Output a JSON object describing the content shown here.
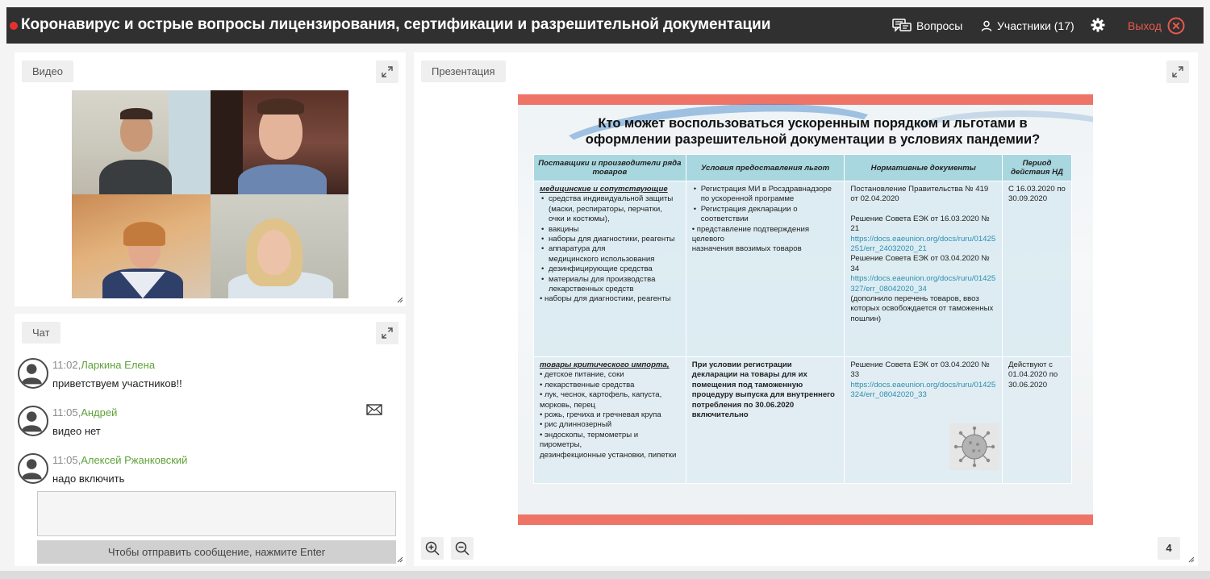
{
  "header": {
    "title": "Коронавирус и острые вопросы лицензирования, сертификации и разрешительной документации",
    "questions_label": "Вопросы",
    "participants_label": "Участники (17)",
    "exit_label": "Выход"
  },
  "video": {
    "tab_label": "Видео"
  },
  "chat": {
    "tab_label": "Чат",
    "messages": [
      {
        "time": "11:02,",
        "author": "Ларкина Елена",
        "text": "приветствуем участников!!"
      },
      {
        "time": "11:05,",
        "author": "Андрей",
        "text": "видео нет"
      },
      {
        "time": "11:05,",
        "author": "Алексей Ржанковский",
        "text": "надо включить"
      }
    ],
    "send_hint": "Чтобы отправить сообщение, нажмите Enter"
  },
  "presentation": {
    "tab_label": "Презентация",
    "page_number": "4",
    "slide": {
      "title_line1": "Кто может воспользоваться ускоренным порядком и льготами в",
      "title_line2": "оформлении разрешительной документации в условиях пандемии?",
      "headers": {
        "c1": "Поставщики и производители ряда товаров",
        "c2": "Условия предоставления льгот",
        "c3": "Нормативные документы",
        "c4": "Период действия НД"
      },
      "row1": {
        "category": "медицинские и сопутствующие",
        "items": [
          "средства индивидуальной защиты (маски, респираторы, перчатки, очки и костюмы),",
          "вакцины",
          "наборы для диагностики, реагенты",
          "аппаратура для",
          "медицинского использования",
          "дезинфицирующие средства",
          "материалы для производства лекарственных средств",
          "• наборы для диагностики, реагенты"
        ],
        "conditions": [
          "Регистрация МИ в Росздравнадзоре по ускоренной программе",
          "Регистрация декларации  о соответствии",
          "• представление подтверждения целевого",
          "назначения ввозимых товаров"
        ],
        "docs": {
          "d1": "Постановление Правительства № 419 от 02.04.2020",
          "d2": "Решение Совета ЕЭК от 16.03.2020 № 21",
          "l1": "https://docs.eaeunion.org/docs/ruru/01425251/err_24032020_21",
          "d3": "Решение Совета ЕЭК от 03.04.2020 № 34",
          "l2": "https://docs.eaeunion.org/docs/ruru/01425327/err_08042020_34",
          "d4": "(дополнило перечень товаров, ввоз которых освобождается от таможенных пошлин)"
        },
        "period": "С 16.03.2020 по 30.09.2020"
      },
      "row2": {
        "category": "товары критического импорта,",
        "items": [
          "• детское питание, соки",
          "• лекарственные средства",
          "• лук, чеснок, картофель, капуста, морковь, перец",
          "• рожь, гречиха и гречневая крупа",
          "• рис длиннозерный",
          "• эндоскопы, термометры и пирометры,",
          "дезинфекционные установки, пипетки"
        ],
        "conditions": "При условии регистрации декларации на товары для их помещения под таможенную процедуру выпуска для внутреннего потребления по 30.06.2020 включительно",
        "docs": {
          "d1": "Решение Совета ЕЭК от 03.04.2020 № 33",
          "l1": "https://docs.eaeunion.org/docs/ruru/01425324/err_08042020_33"
        },
        "period": "Действуют с 01.04.2020 по 30.06.2020"
      }
    }
  },
  "colors": {
    "topbar": "#303030",
    "record": "#e63030",
    "exit": "#e85a4f",
    "author": "#5fa23a",
    "slide_accent": "#ef7468",
    "table_header": "#a9d7df",
    "link": "#2a8fb2"
  },
  "icons": [
    "record-dot-icon",
    "questions-icon",
    "user-icon",
    "gear-icon",
    "close-circle-icon",
    "expand-icon",
    "mail-icon",
    "zoom-in-icon",
    "zoom-out-icon",
    "resize-grip-icon",
    "avatar-icon",
    "virus-icon"
  ]
}
